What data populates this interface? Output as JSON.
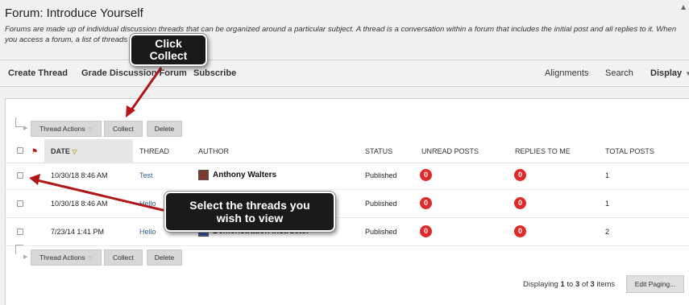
{
  "page": {
    "title": "Forum: Introduce Yourself",
    "description": "Forums are made up of individual discussion threads that can be organized around a particular subject. A thread is a conversation within a forum that includes the initial post and all replies to it. When you access a forum, a list of threads appea"
  },
  "actionbar": {
    "create_thread": "Create Thread",
    "grade_forum": "Grade Discussion Forum",
    "subscribe": "Subscribe",
    "alignments": "Alignments",
    "search": "Search",
    "display": "Display"
  },
  "buttons": {
    "thread_actions": "Thread Actions",
    "collect": "Collect",
    "delete": "Delete",
    "edit_paging": "Edit Paging..."
  },
  "table": {
    "headers": {
      "date": "DATE",
      "thread": "THREAD",
      "author": "AUTHOR",
      "status": "STATUS",
      "unread": "UNREAD POSTS",
      "replies": "REPLIES TO ME",
      "total": "TOTAL POSTS"
    },
    "rows": [
      {
        "date": "10/30/18 8:46 AM",
        "thread": "Test",
        "author": "Anthony Walters",
        "status": "Published",
        "unread": "0",
        "replies": "0",
        "total": "1"
      },
      {
        "date": "10/30/18 8:46 AM",
        "thread": "Hello",
        "author": "",
        "status": "Published",
        "unread": "0",
        "replies": "0",
        "total": "1"
      },
      {
        "date": "7/23/14 1:41 PM",
        "thread": "Hello",
        "author": "Demonstration Instructor",
        "status": "Published",
        "unread": "0",
        "replies": "0",
        "total": "2"
      }
    ]
  },
  "paging": {
    "prefix": "Displaying",
    "from": "1",
    "to_word": "to",
    "to": "3",
    "of_word": "of",
    "total": "3",
    "suffix": "items"
  },
  "callouts": {
    "collect_line1": "Click",
    "collect_line2": "Collect",
    "select_line1": "Select the threads you",
    "select_line2": "wish to view"
  },
  "colors": {
    "badge": "#e02a2a",
    "link": "#30609a",
    "arrow": "#b01818"
  }
}
